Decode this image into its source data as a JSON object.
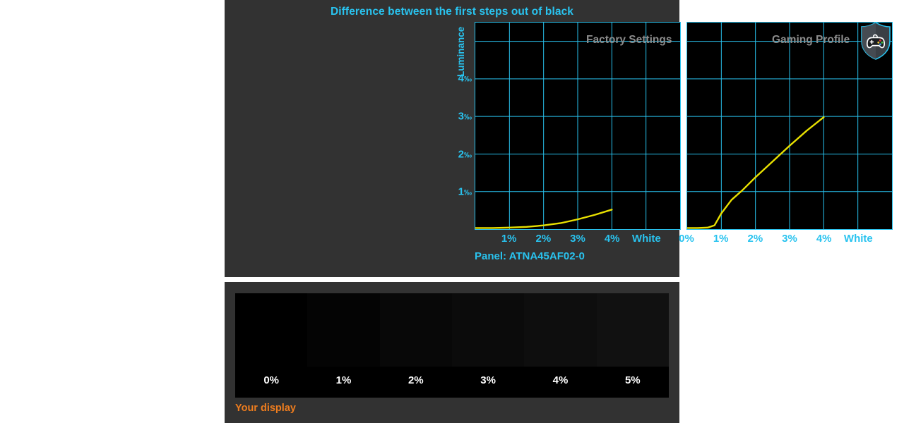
{
  "chart_title": "Difference between the first steps out of black",
  "panel_name": "Panel: ATNA45AF02-0",
  "axes": {
    "y_title": "Luminance",
    "y_ticks": [
      "1",
      "2",
      "3",
      "4"
    ],
    "permille_symbol": "‰",
    "x_ticks_left": [
      "1%",
      "2%",
      "3%",
      "4%",
      "White"
    ],
    "x_ticks_right": [
      "0%",
      "1%",
      "2%",
      "3%",
      "4%",
      "White"
    ]
  },
  "charts": [
    {
      "label": "Factory Settings",
      "badge": null
    },
    {
      "label": "Gaming Profile",
      "badge": "gamepad-shield-icon"
    }
  ],
  "colors": {
    "accent_cyan": "#29c3ef",
    "grid_cyan": "#29c3ef",
    "curve_yellow": "#e8e000",
    "panel_bg": "#323232",
    "plot_bg": "#000000",
    "chart_label_gray": "#8c8c8c",
    "your_display_orange": "#ef7d1e"
  },
  "gradient_strip": {
    "caption": "Your display",
    "swatches": [
      {
        "label": "0%",
        "color": "#000000"
      },
      {
        "label": "1%",
        "color": "#040404"
      },
      {
        "label": "2%",
        "color": "#080808"
      },
      {
        "label": "3%",
        "color": "#0b0b0b"
      },
      {
        "label": "4%",
        "color": "#0e0e0e"
      },
      {
        "label": "5%",
        "color": "#111111"
      }
    ]
  },
  "chart_data": [
    {
      "type": "line",
      "title": "Factory Settings",
      "xlabel": "",
      "ylabel": "Luminance",
      "yunit": "‰",
      "xlim": [
        0,
        6
      ],
      "ylim": [
        0,
        5.5
      ],
      "grid": true,
      "x_categories": [
        "0%",
        "1%",
        "2%",
        "3%",
        "4%",
        "White"
      ],
      "x_tick_labels": [
        "1%",
        "2%",
        "3%",
        "4%",
        "White"
      ],
      "y_tick_values": [
        1,
        2,
        3,
        4
      ],
      "series": [
        {
          "name": "Factory Settings",
          "color": "#e8e000",
          "x": [
            0.0,
            0.5,
            1.0,
            1.5,
            2.0,
            2.5,
            3.0,
            3.5,
            4.0
          ],
          "values": [
            0.03,
            0.03,
            0.04,
            0.06,
            0.1,
            0.16,
            0.26,
            0.38,
            0.52
          ]
        }
      ]
    },
    {
      "type": "line",
      "title": "Gaming Profile",
      "xlabel": "",
      "ylabel": "Luminance",
      "yunit": "‰",
      "xlim": [
        0,
        6
      ],
      "ylim": [
        0,
        5.5
      ],
      "grid": true,
      "x_categories": [
        "0%",
        "1%",
        "2%",
        "3%",
        "4%",
        "White"
      ],
      "x_tick_labels": [
        "0%",
        "1%",
        "2%",
        "3%",
        "4%",
        "White"
      ],
      "y_tick_values": [
        1,
        2,
        3,
        4
      ],
      "series": [
        {
          "name": "Gaming Profile",
          "color": "#e8e000",
          "x": [
            0.0,
            0.3,
            0.6,
            0.8,
            1.0,
            1.3,
            1.6,
            2.0,
            2.5,
            3.0,
            3.5,
            4.0
          ],
          "values": [
            0.03,
            0.03,
            0.04,
            0.1,
            0.42,
            0.78,
            1.02,
            1.38,
            1.8,
            2.22,
            2.62,
            2.98
          ]
        }
      ]
    }
  ]
}
